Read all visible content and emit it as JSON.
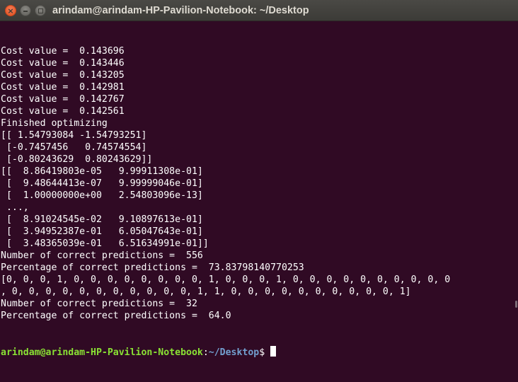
{
  "window": {
    "title": "arindam@arindam-HP-Pavilion-Notebook: ~/Desktop",
    "close_symbol": "×"
  },
  "terminal": {
    "lines": [
      "Cost value =  0.143696",
      "Cost value =  0.143446",
      "Cost value =  0.143205",
      "Cost value =  0.142981",
      "Cost value =  0.142767",
      "Cost value =  0.142561",
      "Finished optimizing",
      "[[ 1.54793084 -1.54793251]",
      " [-0.7457456   0.74574554]",
      " [-0.80243629  0.80243629]]",
      "[[  8.86419803e-05   9.99911308e-01]",
      " [  9.48644413e-07   9.99999046e-01]",
      " [  1.00000000e+00   2.54803096e-13]",
      " ...,",
      " [  8.91024545e-02   9.10897613e-01]",
      " [  3.94952387e-01   6.05047643e-01]",
      " [  3.48365039e-01   6.51634991e-01]]",
      "Number of correct predictions =  556",
      "Percentage of correct predictions =  73.83798140770253",
      "[0, 0, 0, 1, 0, 0, 0, 0, 0, 0, 0, 0, 1, 0, 0, 0, 1, 0, 0, 0, 0, 0, 0, 0, 0, 0, 0",
      ", 0, 0, 0, 0, 0, 0, 0, 0, 0, 0, 0, 1, 1, 0, 0, 0, 0, 0, 0, 0, 0, 0, 0, 1]",
      "Number of correct predictions =  32",
      "Percentage of correct predictions =  64.0"
    ],
    "prompt": {
      "user_host": "arindam@arindam-HP-Pavilion-Notebook",
      "separator": ":",
      "path": "~/Desktop",
      "symbol": "$ "
    }
  },
  "colors": {
    "background": "#300a24",
    "text": "#ffffff",
    "prompt_user": "#8ae234",
    "prompt_path": "#729fcf",
    "close_button": "#e0501f"
  }
}
